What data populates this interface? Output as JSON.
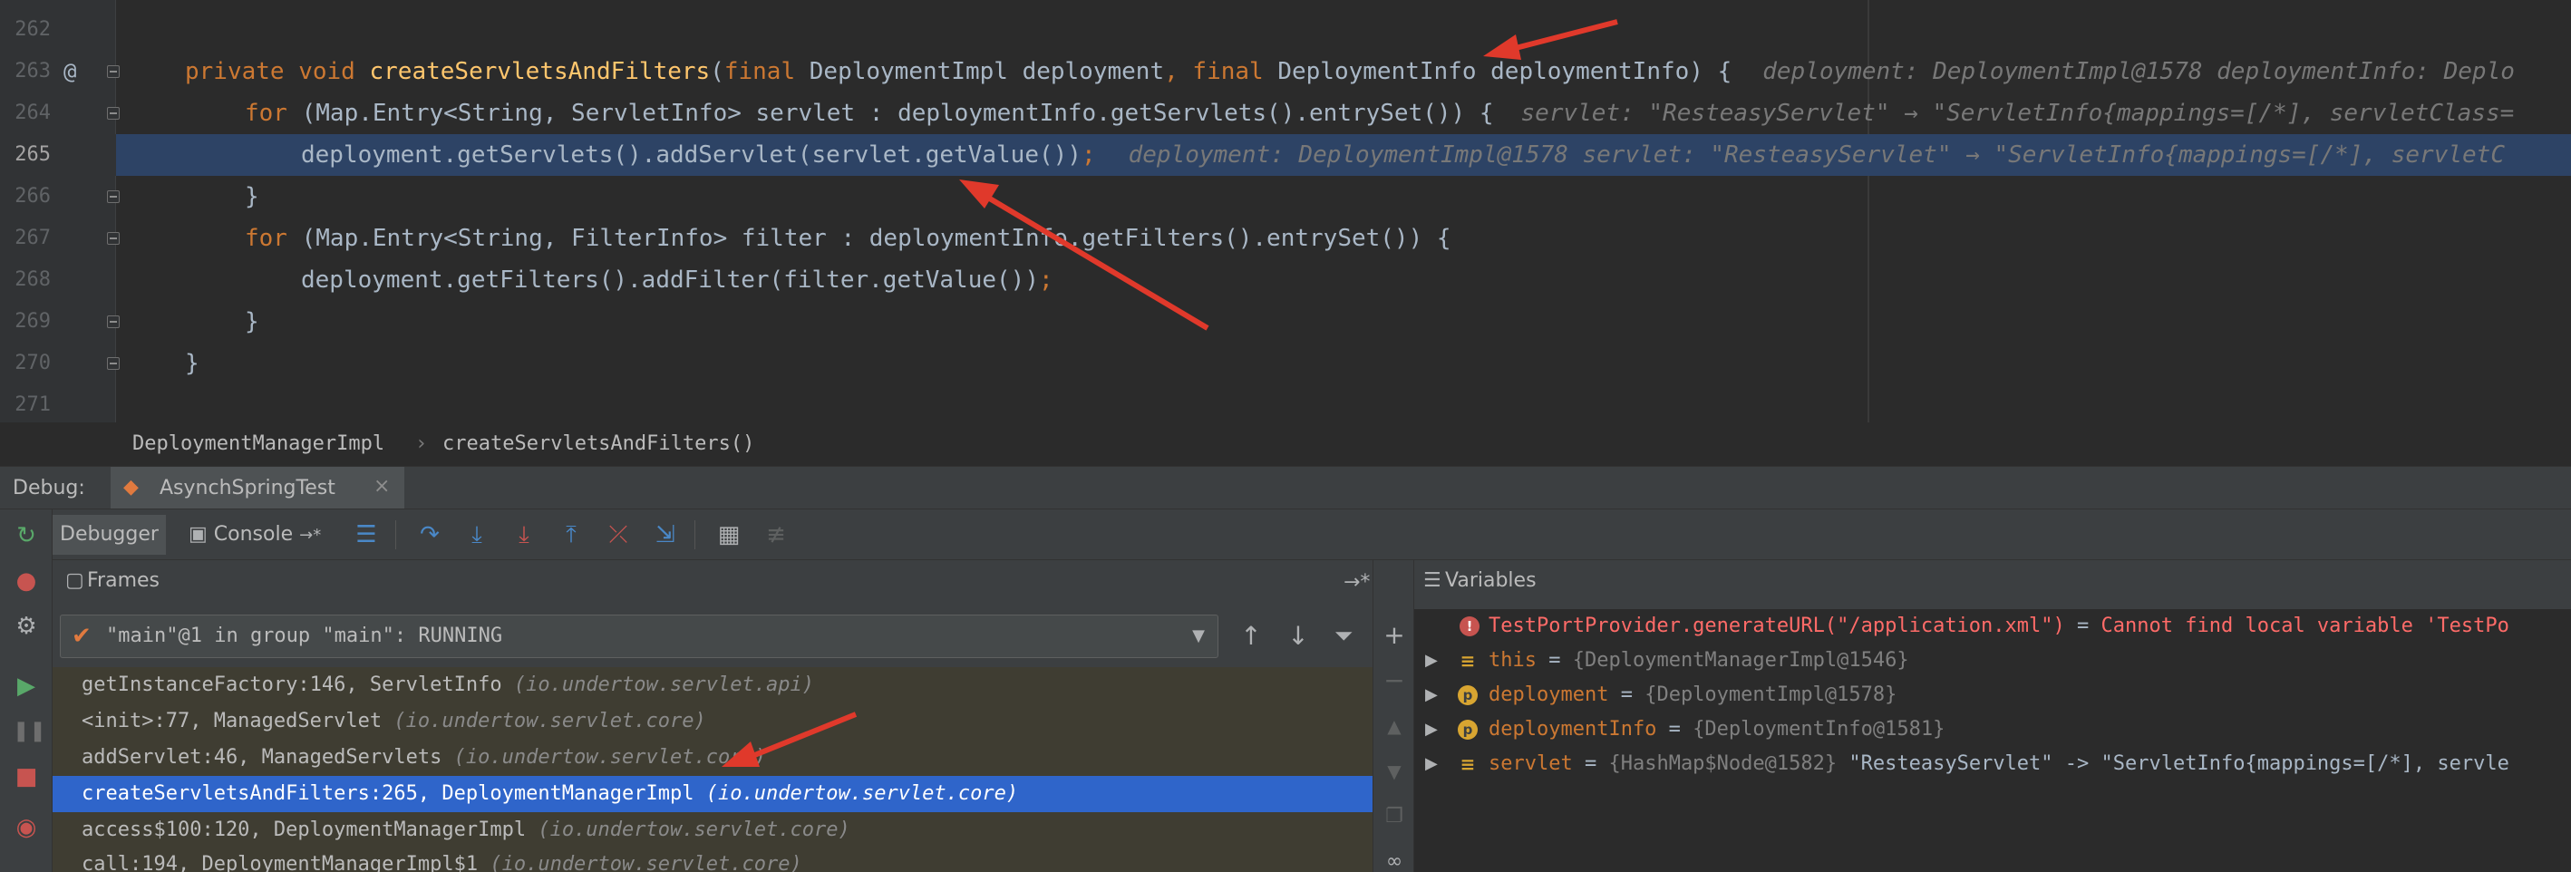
{
  "editor": {
    "lines": [
      {
        "num": "262"
      },
      {
        "num": "263",
        "segments": [
          {
            "cls": "kw",
            "text": "private void "
          },
          {
            "cls": "fn",
            "text": "createServletsAndFilters"
          },
          {
            "cls": "pl",
            "text": "("
          },
          {
            "cls": "kw",
            "text": "final "
          },
          {
            "cls": "pl",
            "text": "DeploymentImpl deployment"
          },
          {
            "cls": "kw",
            "text": ", final "
          },
          {
            "cls": "pl",
            "text": "DeploymentInfo deploymentInfo) {"
          }
        ],
        "hint": "deployment: DeploymentImpl@1578  deploymentInfo: Deplo"
      },
      {
        "num": "264",
        "segments": [
          {
            "cls": "kw",
            "text": "for "
          },
          {
            "cls": "pl",
            "text": "(Map.Entry<String, ServletInfo> servlet : deploymentInfo.getServlets().entrySet()) {"
          }
        ],
        "hint": "servlet: \"ResteasyServlet\" → \"ServletInfo{mappings=[/*], servletClass="
      },
      {
        "num": "265",
        "segments": [
          {
            "cls": "pl",
            "text": "deployment.getServlets().addServlet(servlet.getValue())"
          },
          {
            "cls": "kw",
            "text": ";"
          }
        ],
        "hint": "deployment: DeploymentImpl@1578  servlet: \"ResteasyServlet\" → \"ServletInfo{mappings=[/*], servletC"
      },
      {
        "num": "266",
        "segments": [
          {
            "cls": "pl",
            "text": "}"
          }
        ]
      },
      {
        "num": "267",
        "segments": [
          {
            "cls": "kw",
            "text": "for "
          },
          {
            "cls": "pl",
            "text": "(Map.Entry<String, FilterInfo> filter : deploymentInfo.getFilters().entrySet()) {"
          }
        ]
      },
      {
        "num": "268",
        "segments": [
          {
            "cls": "pl",
            "text": "deployment.getFilters().addFilter(filter.getValue())"
          },
          {
            "cls": "kw",
            "text": ";"
          }
        ]
      },
      {
        "num": "269",
        "segments": [
          {
            "cls": "pl",
            "text": "}"
          }
        ]
      },
      {
        "num": "270",
        "segments": [
          {
            "cls": "pl",
            "text": "}"
          }
        ]
      },
      {
        "num": "271"
      }
    ],
    "gutter_marker": "@"
  },
  "breadcrumb": {
    "class_name": "DeploymentManagerImpl",
    "separator": "›",
    "method_name": "createServletsAndFilters()"
  },
  "debug": {
    "label": "Debug:",
    "session_tab": "AsynchSpringTest",
    "session_close": "×",
    "tabs": {
      "debugger": "Debugger",
      "console": "Console",
      "console_suffix": "→*"
    }
  },
  "frames": {
    "title": "Frames",
    "restore_icon": "→*",
    "thread": "\"main\"@1 in group \"main\": RUNNING",
    "rows": [
      {
        "method": "getInstanceFactory:146, ServletInfo",
        "package": "(io.undertow.servlet.api)"
      },
      {
        "method": "<init>:77, ManagedServlet",
        "package": "(io.undertow.servlet.core)"
      },
      {
        "method": "addServlet:46, ManagedServlets",
        "package": "(io.undertow.servlet.core)"
      },
      {
        "method": "createServletsAndFilters:265, DeploymentManagerImpl",
        "package": "(io.undertow.servlet.core)",
        "selected": true
      },
      {
        "method": "access$100:120, DeploymentManagerImpl",
        "package": "(io.undertow.servlet.core)"
      },
      {
        "method": "call:194, DeploymentManagerImpl$1",
        "package": "(io.undertow.servlet.core)"
      }
    ]
  },
  "variables": {
    "title": "Variables",
    "rows": [
      {
        "icon": "!",
        "kind": "err",
        "name": "TestPortProvider.generateURL(\"/application.xml\")",
        "eq": " = ",
        "error": "Cannot find local variable 'TestPo"
      },
      {
        "icon": "≡",
        "kind": "fld",
        "name": "this",
        "eq": " = ",
        "obj": "{DeploymentManagerImpl@1546}"
      },
      {
        "icon": "p",
        "kind": "p",
        "name": "deployment",
        "eq": " = ",
        "obj": "{DeploymentImpl@1578}"
      },
      {
        "icon": "p",
        "kind": "p",
        "name": "deploymentInfo",
        "eq": " = ",
        "obj": "{DeploymentInfo@1581}"
      },
      {
        "icon": "≡",
        "kind": "fld",
        "name": "servlet",
        "eq": " = ",
        "obj": "{HashMap$Node@1582} ",
        "value": "\"ResteasyServlet\" -> \"ServletInfo{mappings=[/*], servle"
      }
    ]
  },
  "colors": {
    "editor_bg": "#2B2B2B",
    "keyword": "#CC7832",
    "function": "#FFC66D",
    "current_line": "#2D4365",
    "selected_frame": "#2F65CA",
    "annotation_arrow": "#E0392B"
  }
}
